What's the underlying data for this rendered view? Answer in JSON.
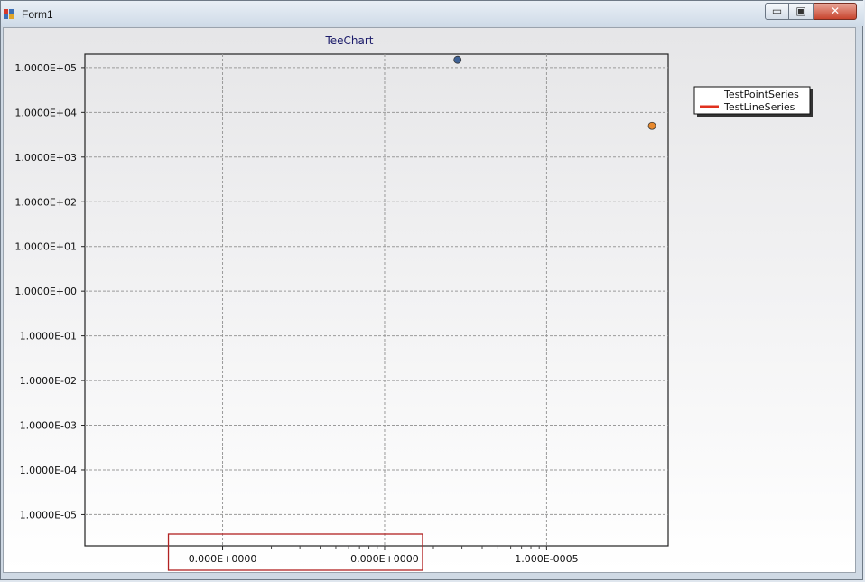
{
  "window": {
    "title": "Form1",
    "min_glyph": "▭",
    "max_glyph": "▣",
    "close_glyph": "✕"
  },
  "chart_data": {
    "type": "scatter",
    "title": "TeeChart",
    "xlabel": "",
    "ylabel": "",
    "y_scale": "log",
    "ylim": [
      2e-06,
      200000
    ],
    "xlim": [
      -3.7e-06,
      3.5e-06
    ],
    "y_ticks": [
      100000,
      10000,
      1000,
      100,
      10,
      1,
      0.1,
      0.01,
      0.001,
      0.0001,
      1e-05
    ],
    "y_tick_labels": [
      "1.0000E+05",
      "1.0000E+04",
      "1.0000E+03",
      "1.0000E+02",
      "1.0000E+01",
      "1.0000E+00",
      "1.0000E-01",
      "1.0000E-02",
      "1.0000E-03",
      "1.0000E-04",
      "1.0000E-05"
    ],
    "x_ticks": [
      -2e-06,
      0,
      2e-06
    ],
    "x_tick_labels": [
      "0.000E+0000",
      "0.000E+0000",
      "1.000E-0005"
    ],
    "grid": true,
    "legend_position": "right",
    "highlight_box_color": "#b22222",
    "series": [
      {
        "name": "TestPointSeries",
        "type": "point",
        "color": "#3f6296",
        "legend_marker": "none",
        "points": [
          {
            "x": 9e-07,
            "y": 150000
          }
        ]
      },
      {
        "name": "TestLineSeries",
        "type": "line",
        "color": "#e0301e",
        "legend_marker": "line",
        "points": [
          {
            "x": 3.3e-06,
            "y": 5000
          }
        ],
        "point_color": "#e8892e"
      }
    ]
  }
}
